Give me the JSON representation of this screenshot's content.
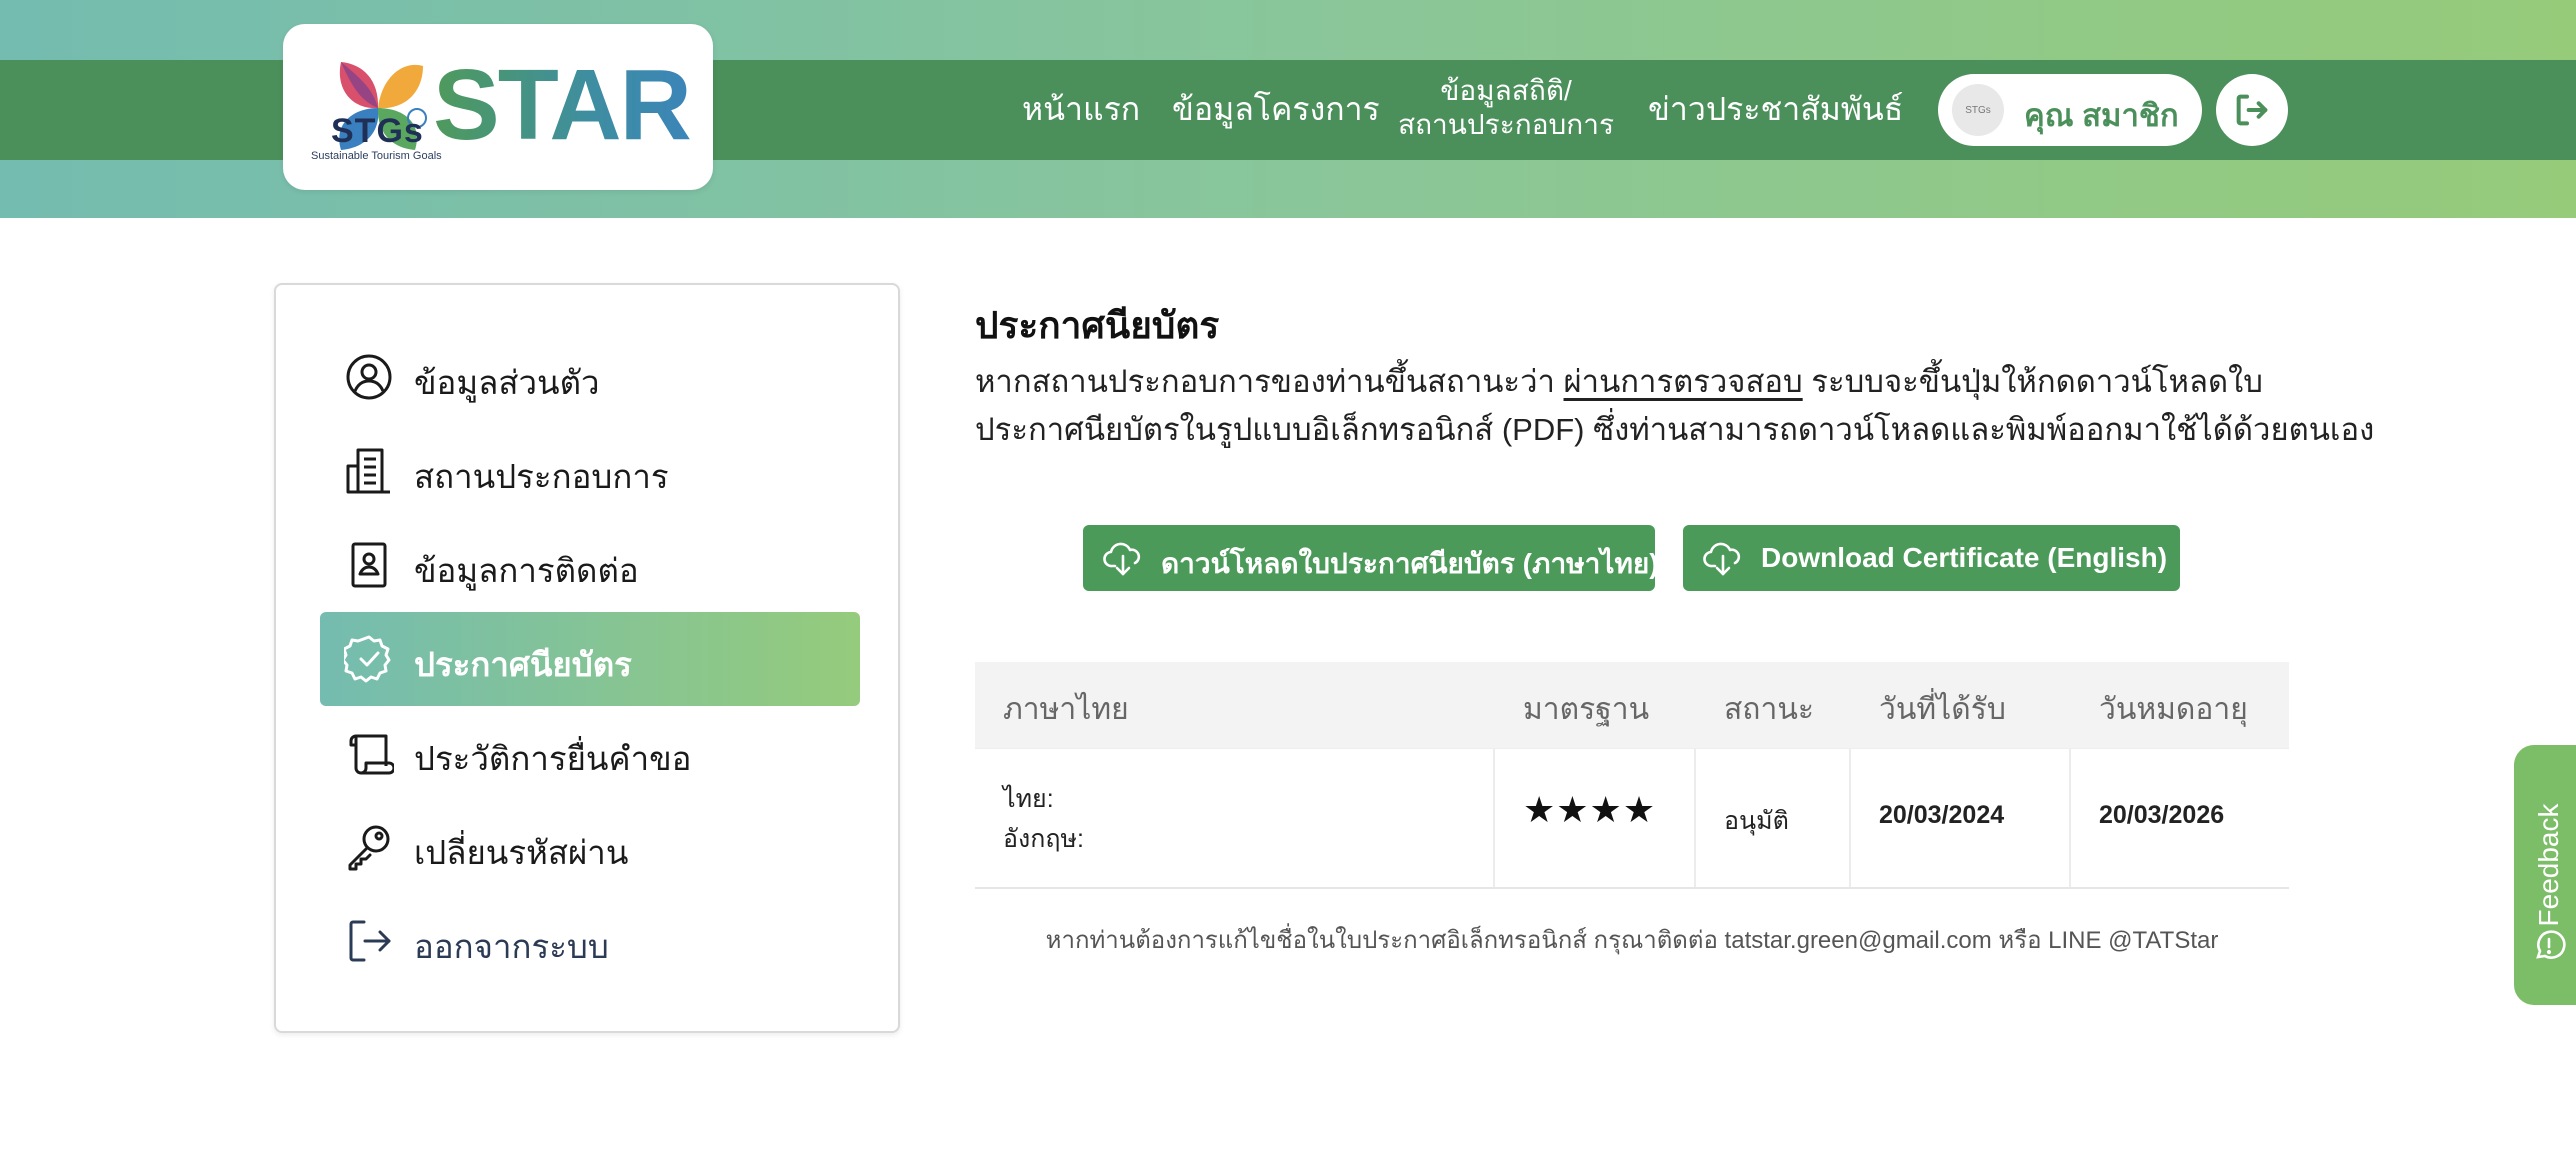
{
  "brand": {
    "logo_stgs": "STGs",
    "logo_subtitle": "Sustainable Tourism Goals",
    "logo_star": "STAR",
    "colors": {
      "primary_green": "#4b8f5b",
      "gradient_start": "#74bcb0",
      "gradient_end": "#96cb7a",
      "button_green": "#4b9a5a"
    }
  },
  "nav": {
    "home": "หน้าแรก",
    "project_info": "ข้อมูลโครงการ",
    "stats_line1": "ข้อมูลสถิติ/",
    "stats_line2": "สถานประกอบการ",
    "news": "ข่าวประชาสัมพันธ์",
    "member_name": "คุณ สมาชิก",
    "avatar_text": "STGs",
    "logout_icon": "logout-icon"
  },
  "sidebar": {
    "items": [
      {
        "label": "ข้อมูลส่วนตัว",
        "icon": "user-circle-icon"
      },
      {
        "label": "สถานประกอบการ",
        "icon": "building-icon"
      },
      {
        "label": "ข้อมูลการติดต่อ",
        "icon": "contact-book-icon"
      },
      {
        "label": "ประกาศนียบัตร",
        "icon": "certificate-badge-icon",
        "active": true
      },
      {
        "label": "ประวัติการยื่นคำขอ",
        "icon": "scroll-icon"
      },
      {
        "label": "เปลี่ยนรหัสผ่าน",
        "icon": "key-icon"
      },
      {
        "label": "ออกจากระบบ",
        "icon": "logout-icon"
      }
    ]
  },
  "main": {
    "title": "ประกาศนียบัตร",
    "desc_part1": "หากสถานประกอบการของท่านขึ้นสถานะว่า ",
    "desc_link": "ผ่านการตรวจสอบ",
    "desc_part2": " ระบบจะขึ้นปุ่มให้กดดาวน์โหลดใบประกาศนียบัตรในรูปแบบอิเล็กทรอนิกส์ (PDF) ซึ่งท่านสามารถดาวน์โหลดและพิมพ์ออกมาใช้ได้ด้วยตนเอง",
    "btn_thai": "ดาวน์โหลดใบประกาศนียบัตร (ภาษาไทย)",
    "btn_english": "Download Certificate (English)"
  },
  "table": {
    "headers": [
      "ภาษาไทย",
      "มาตรฐาน",
      "สถานะ",
      "วันที่ได้รับ",
      "วันหมดอายุ"
    ],
    "row": {
      "lang_thai": "ไทย:",
      "lang_english": "อังกฤษ:",
      "standard_stars": "★★★★",
      "standard_rating": 4,
      "status": "อนุมัติ",
      "received_date": "20/03/2024",
      "expiry_date": "20/03/2026"
    }
  },
  "footnote": "หากท่านต้องการแก้ไขชื่อในใบประกาศอิเล็กทรอนิกส์ กรุณาติดต่อ tatstar.green@gmail.com หรือ LINE @TATStar",
  "feedback": {
    "label": "Feedback",
    "icon": "feedback-chat-icon"
  }
}
